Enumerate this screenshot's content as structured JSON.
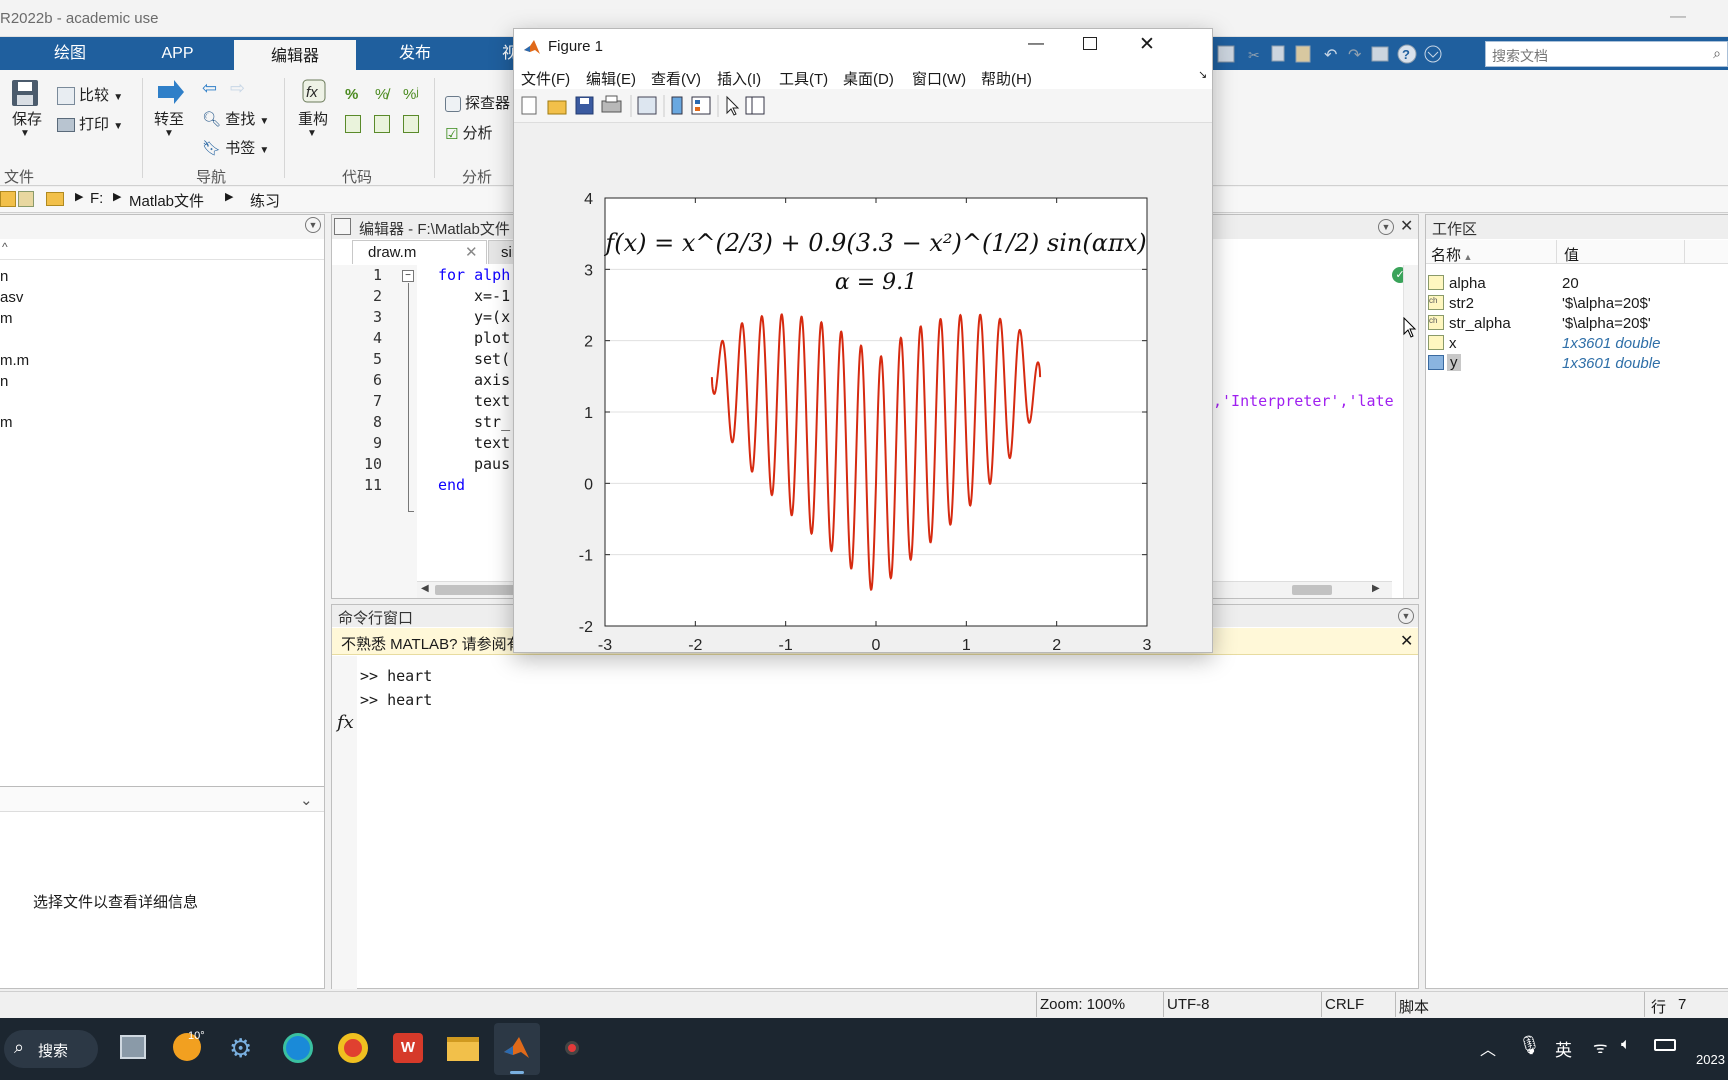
{
  "app": {
    "title": "R2022b - academic use"
  },
  "tabs": [
    "绘图",
    "APP",
    "编辑器",
    "发布",
    "视"
  ],
  "search_docs": {
    "placeholder": "搜索文档"
  },
  "ribbon": {
    "file": {
      "save": "保存",
      "compare": "比较",
      "print": "打印",
      "group": "文件"
    },
    "nav": {
      "goto": "转至",
      "find": "查找",
      "bookmark": "书签",
      "group": "导航"
    },
    "code": {
      "refactor": "重构",
      "group": "代码"
    },
    "analyze": {
      "explorer": "探查器",
      "analyze": "分析",
      "group": "分析"
    }
  },
  "address": {
    "drive": "F:",
    "folder1": "Matlab文件",
    "folder2": "练习"
  },
  "file_browser": {
    "items": [
      "n",
      "asv",
      "m",
      "m.m",
      "n",
      "m"
    ],
    "details_hint": "选择文件以查看详细信息"
  },
  "editor": {
    "title": "编辑器 - F:\\Matlab文件",
    "tabs": [
      "draw.m",
      "sinx.m"
    ],
    "line_numbers": [
      "1",
      "2",
      "3",
      "4",
      "5",
      "6",
      "7",
      "8",
      "9",
      "10",
      "11"
    ],
    "lines": [
      "for alph",
      "x=-1",
      "y=(x",
      "plot",
      "set(",
      "axis",
      "text",
      "str_",
      "text",
      "paus",
      "end"
    ],
    "overflow_text": ",'Interpreter','late"
  },
  "command_window": {
    "title": "命令行窗口",
    "notice": "不熟悉 MATLAB? 请参阅有",
    "history": [
      ">> heart",
      ">> heart"
    ],
    "fx": "fx"
  },
  "workspace": {
    "title": "工作区",
    "col_name": "名称",
    "col_value": "值",
    "vars": [
      {
        "name": "alpha",
        "value": "20"
      },
      {
        "name": "str2",
        "value": "'$\\alpha=20$'"
      },
      {
        "name": "str_alpha",
        "value": "'$\\alpha=20$'"
      },
      {
        "name": "x",
        "value": "1x3601 double"
      },
      {
        "name": "y",
        "value": "1x3601 double"
      }
    ]
  },
  "figure": {
    "title": "Figure 1",
    "menu": [
      "文件(F)",
      "编辑(E)",
      "查看(V)",
      "插入(I)",
      "工具(T)",
      "桌面(D)",
      "窗口(W)",
      "帮助(H)"
    ]
  },
  "chart_data": {
    "type": "line",
    "title": "f(x) = x^(2/3) + 0.9(3.3 − x²)^(1/2) sin(απx)",
    "annotation": "α = 9.1",
    "xlim": [
      -3,
      3
    ],
    "ylim": [
      -2,
      4
    ],
    "xticks": [
      "-3",
      "-2",
      "-1",
      "0",
      "1",
      "2",
      "3"
    ],
    "yticks": [
      "4",
      "3",
      "2",
      "1",
      "0",
      "-1",
      "-2"
    ],
    "grid": "y",
    "series": [
      {
        "color": "#d62a10",
        "function": "x^(2/3) + 0.9*sqrt(3.3 - x^2)*sin(9.1*pi*x)",
        "x_range": [
          -1.8166,
          1.8166
        ]
      }
    ]
  },
  "status": {
    "zoom": "Zoom: 100%",
    "encoding": "UTF-8",
    "eol": "CRLF",
    "type": "脚本",
    "line": "行",
    "line_no": "7"
  },
  "taskbar": {
    "search": "搜索",
    "weather": "10°",
    "ime": "英",
    "year": "2023"
  }
}
